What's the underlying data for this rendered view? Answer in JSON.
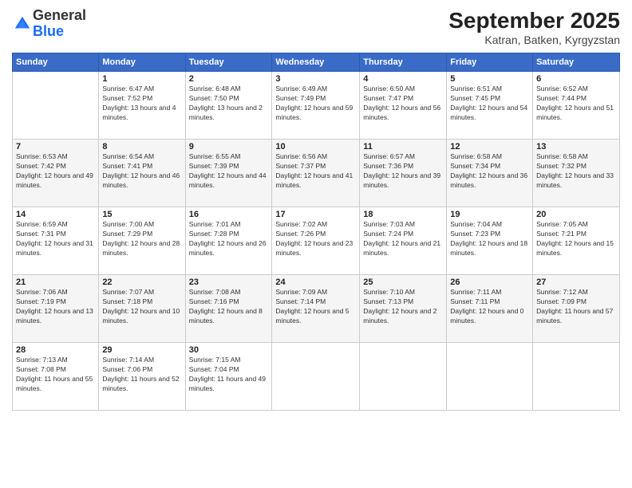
{
  "logo": {
    "general": "General",
    "blue": "Blue"
  },
  "header": {
    "month": "September 2025",
    "location": "Katran, Batken, Kyrgyzstan"
  },
  "weekdays": [
    "Sunday",
    "Monday",
    "Tuesday",
    "Wednesday",
    "Thursday",
    "Friday",
    "Saturday"
  ],
  "weeks": [
    [
      {
        "day": "",
        "sunrise": "",
        "sunset": "",
        "daylight": ""
      },
      {
        "day": "1",
        "sunrise": "Sunrise: 6:47 AM",
        "sunset": "Sunset: 7:52 PM",
        "daylight": "Daylight: 13 hours and 4 minutes."
      },
      {
        "day": "2",
        "sunrise": "Sunrise: 6:48 AM",
        "sunset": "Sunset: 7:50 PM",
        "daylight": "Daylight: 13 hours and 2 minutes."
      },
      {
        "day": "3",
        "sunrise": "Sunrise: 6:49 AM",
        "sunset": "Sunset: 7:49 PM",
        "daylight": "Daylight: 12 hours and 59 minutes."
      },
      {
        "day": "4",
        "sunrise": "Sunrise: 6:50 AM",
        "sunset": "Sunset: 7:47 PM",
        "daylight": "Daylight: 12 hours and 56 minutes."
      },
      {
        "day": "5",
        "sunrise": "Sunrise: 6:51 AM",
        "sunset": "Sunset: 7:45 PM",
        "daylight": "Daylight: 12 hours and 54 minutes."
      },
      {
        "day": "6",
        "sunrise": "Sunrise: 6:52 AM",
        "sunset": "Sunset: 7:44 PM",
        "daylight": "Daylight: 12 hours and 51 minutes."
      }
    ],
    [
      {
        "day": "7",
        "sunrise": "Sunrise: 6:53 AM",
        "sunset": "Sunset: 7:42 PM",
        "daylight": "Daylight: 12 hours and 49 minutes."
      },
      {
        "day": "8",
        "sunrise": "Sunrise: 6:54 AM",
        "sunset": "Sunset: 7:41 PM",
        "daylight": "Daylight: 12 hours and 46 minutes."
      },
      {
        "day": "9",
        "sunrise": "Sunrise: 6:55 AM",
        "sunset": "Sunset: 7:39 PM",
        "daylight": "Daylight: 12 hours and 44 minutes."
      },
      {
        "day": "10",
        "sunrise": "Sunrise: 6:56 AM",
        "sunset": "Sunset: 7:37 PM",
        "daylight": "Daylight: 12 hours and 41 minutes."
      },
      {
        "day": "11",
        "sunrise": "Sunrise: 6:57 AM",
        "sunset": "Sunset: 7:36 PM",
        "daylight": "Daylight: 12 hours and 39 minutes."
      },
      {
        "day": "12",
        "sunrise": "Sunrise: 6:58 AM",
        "sunset": "Sunset: 7:34 PM",
        "daylight": "Daylight: 12 hours and 36 minutes."
      },
      {
        "day": "13",
        "sunrise": "Sunrise: 6:58 AM",
        "sunset": "Sunset: 7:32 PM",
        "daylight": "Daylight: 12 hours and 33 minutes."
      }
    ],
    [
      {
        "day": "14",
        "sunrise": "Sunrise: 6:59 AM",
        "sunset": "Sunset: 7:31 PM",
        "daylight": "Daylight: 12 hours and 31 minutes."
      },
      {
        "day": "15",
        "sunrise": "Sunrise: 7:00 AM",
        "sunset": "Sunset: 7:29 PM",
        "daylight": "Daylight: 12 hours and 28 minutes."
      },
      {
        "day": "16",
        "sunrise": "Sunrise: 7:01 AM",
        "sunset": "Sunset: 7:28 PM",
        "daylight": "Daylight: 12 hours and 26 minutes."
      },
      {
        "day": "17",
        "sunrise": "Sunrise: 7:02 AM",
        "sunset": "Sunset: 7:26 PM",
        "daylight": "Daylight: 12 hours and 23 minutes."
      },
      {
        "day": "18",
        "sunrise": "Sunrise: 7:03 AM",
        "sunset": "Sunset: 7:24 PM",
        "daylight": "Daylight: 12 hours and 21 minutes."
      },
      {
        "day": "19",
        "sunrise": "Sunrise: 7:04 AM",
        "sunset": "Sunset: 7:23 PM",
        "daylight": "Daylight: 12 hours and 18 minutes."
      },
      {
        "day": "20",
        "sunrise": "Sunrise: 7:05 AM",
        "sunset": "Sunset: 7:21 PM",
        "daylight": "Daylight: 12 hours and 15 minutes."
      }
    ],
    [
      {
        "day": "21",
        "sunrise": "Sunrise: 7:06 AM",
        "sunset": "Sunset: 7:19 PM",
        "daylight": "Daylight: 12 hours and 13 minutes."
      },
      {
        "day": "22",
        "sunrise": "Sunrise: 7:07 AM",
        "sunset": "Sunset: 7:18 PM",
        "daylight": "Daylight: 12 hours and 10 minutes."
      },
      {
        "day": "23",
        "sunrise": "Sunrise: 7:08 AM",
        "sunset": "Sunset: 7:16 PM",
        "daylight": "Daylight: 12 hours and 8 minutes."
      },
      {
        "day": "24",
        "sunrise": "Sunrise: 7:09 AM",
        "sunset": "Sunset: 7:14 PM",
        "daylight": "Daylight: 12 hours and 5 minutes."
      },
      {
        "day": "25",
        "sunrise": "Sunrise: 7:10 AM",
        "sunset": "Sunset: 7:13 PM",
        "daylight": "Daylight: 12 hours and 2 minutes."
      },
      {
        "day": "26",
        "sunrise": "Sunrise: 7:11 AM",
        "sunset": "Sunset: 7:11 PM",
        "daylight": "Daylight: 12 hours and 0 minutes."
      },
      {
        "day": "27",
        "sunrise": "Sunrise: 7:12 AM",
        "sunset": "Sunset: 7:09 PM",
        "daylight": "Daylight: 11 hours and 57 minutes."
      }
    ],
    [
      {
        "day": "28",
        "sunrise": "Sunrise: 7:13 AM",
        "sunset": "Sunset: 7:08 PM",
        "daylight": "Daylight: 11 hours and 55 minutes."
      },
      {
        "day": "29",
        "sunrise": "Sunrise: 7:14 AM",
        "sunset": "Sunset: 7:06 PM",
        "daylight": "Daylight: 11 hours and 52 minutes."
      },
      {
        "day": "30",
        "sunrise": "Sunrise: 7:15 AM",
        "sunset": "Sunset: 7:04 PM",
        "daylight": "Daylight: 11 hours and 49 minutes."
      },
      {
        "day": "",
        "sunrise": "",
        "sunset": "",
        "daylight": ""
      },
      {
        "day": "",
        "sunrise": "",
        "sunset": "",
        "daylight": ""
      },
      {
        "day": "",
        "sunrise": "",
        "sunset": "",
        "daylight": ""
      },
      {
        "day": "",
        "sunrise": "",
        "sunset": "",
        "daylight": ""
      }
    ]
  ]
}
